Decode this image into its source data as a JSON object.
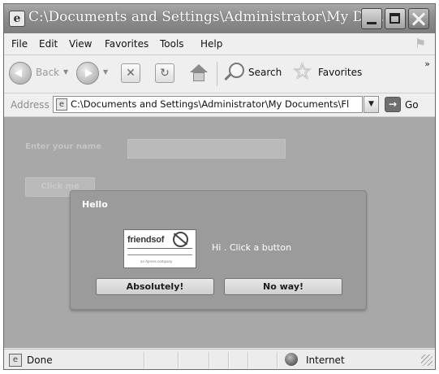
{
  "window": {
    "title": "C:\\Documents and Settings\\Administrator\\My Doc..."
  },
  "menu": {
    "items": [
      "File",
      "Edit",
      "View",
      "Favorites",
      "Tools",
      "Help"
    ]
  },
  "toolbar": {
    "back_label": "Back",
    "dropdown_arrow": "▼",
    "search_label": "Search",
    "favorites_label": "Favorites",
    "more_glyph": "»"
  },
  "address": {
    "label": "Address",
    "value": "C:\\Documents and Settings\\Administrator\\My Documents\\Fl",
    "go_label": "Go"
  },
  "page": {
    "name_label": "Enter your name",
    "name_value": "",
    "click_button_label": "Click me"
  },
  "dialog": {
    "title": "Hello",
    "message": "Hi . Click a button",
    "logo": {
      "word": "friendsof",
      "tagline": "an Apress company"
    },
    "buttons": {
      "yes": "Absolutely!",
      "no": "No way!"
    }
  },
  "status": {
    "text": "Done",
    "zone": "Internet"
  }
}
